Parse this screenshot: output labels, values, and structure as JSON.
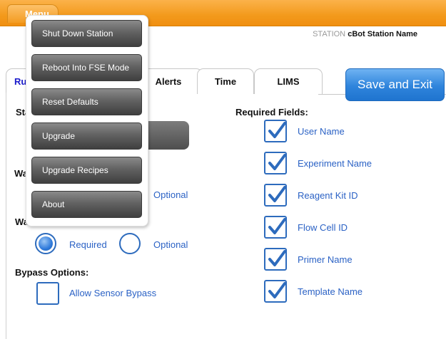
{
  "header": {
    "menu_label": "Menu",
    "station_prefix": "STATION",
    "station_name": "cBot Station Name"
  },
  "tabs": [
    {
      "label": "Run"
    },
    {
      "label": "Alerts"
    },
    {
      "label": "Time"
    },
    {
      "label": "LIMS"
    }
  ],
  "save_button": "Save and Exit",
  "left": {
    "status_label_partial": "Sta",
    "wash_before_label_partial": "Wa",
    "wash_before_optional": "Optional",
    "wash_after_label": "Wash After Run:",
    "wash_after_required": "Required",
    "wash_after_optional": "Optional",
    "bypass_label": "Bypass Options:",
    "bypass_sensor": "Allow Sensor Bypass"
  },
  "required": {
    "title": "Required Fields:",
    "fields": [
      "User Name",
      "Experiment Name",
      "Reagent Kit ID",
      "Flow Cell ID",
      "Primer Name",
      "Template Name"
    ]
  },
  "menu": {
    "items": [
      "Shut Down Station",
      "Reboot Into FSE Mode",
      "Reset Defaults",
      "Upgrade",
      "Upgrade Recipes",
      "About"
    ]
  },
  "colors": {
    "accent_orange": "#f39a1c",
    "button_blue": "#2f84dc",
    "link_blue": "#2b62c5"
  }
}
